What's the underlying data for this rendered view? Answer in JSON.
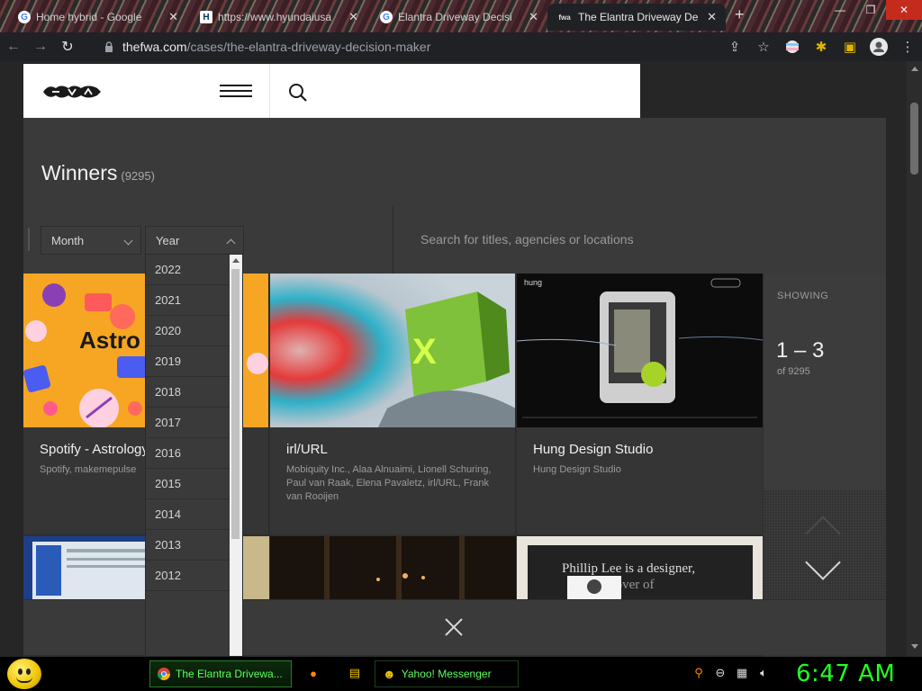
{
  "browser": {
    "tabs": [
      {
        "title": "Home hybrid - Google",
        "favicon": "G"
      },
      {
        "title": "https://www.hyundaiusa",
        "favicon": "H"
      },
      {
        "title": "Elantra Driveway Decisi",
        "favicon": "G"
      },
      {
        "title": "The Elantra Driveway De",
        "favicon": "fwa"
      }
    ],
    "new_tab": "+",
    "url_domain": "thefwa.com",
    "url_path": "/cases/the-elantra-driveway-decision-maker"
  },
  "site": {
    "heading": "Winners",
    "count": "(9295)",
    "filters": {
      "month_label": "Month",
      "year_label": "Year",
      "search_placeholder": "Search for titles, agencies or locations"
    },
    "year_options": [
      "2022",
      "2021",
      "2020",
      "2019",
      "2018",
      "2017",
      "2016",
      "2015",
      "2014",
      "2013",
      "2012"
    ],
    "cards": [
      {
        "title": "Spotify - Astrology",
        "subtitle": "Spotify, makemepulse"
      },
      {
        "title": "irl/URL",
        "subtitle": "Mobiquity Inc., Alaa Alnuaimi, Lionell Schuring, Paul van Raak, Elena Pavaletz, irl/URL, Frank van Rooijen"
      },
      {
        "title": "Hung Design Studio",
        "subtitle": "Hung Design Studio"
      }
    ],
    "card_thumb_text": {
      "astro": "Astro",
      "hung_logo": "hung",
      "phillip": "Phillip Lee is a designer,",
      "phillip2": "and lover of"
    },
    "showing": {
      "label": "SHOWING",
      "range": "1 – 3",
      "of": "of 9295"
    },
    "colors": {
      "accent_green": "#a6d32a",
      "panel": "#3a3a3a"
    }
  },
  "taskbar": {
    "chrome_task": "The Elantra Drivewa...",
    "yahoo_task": "Yahoo! Messenger",
    "clock": "6:47 AM"
  }
}
